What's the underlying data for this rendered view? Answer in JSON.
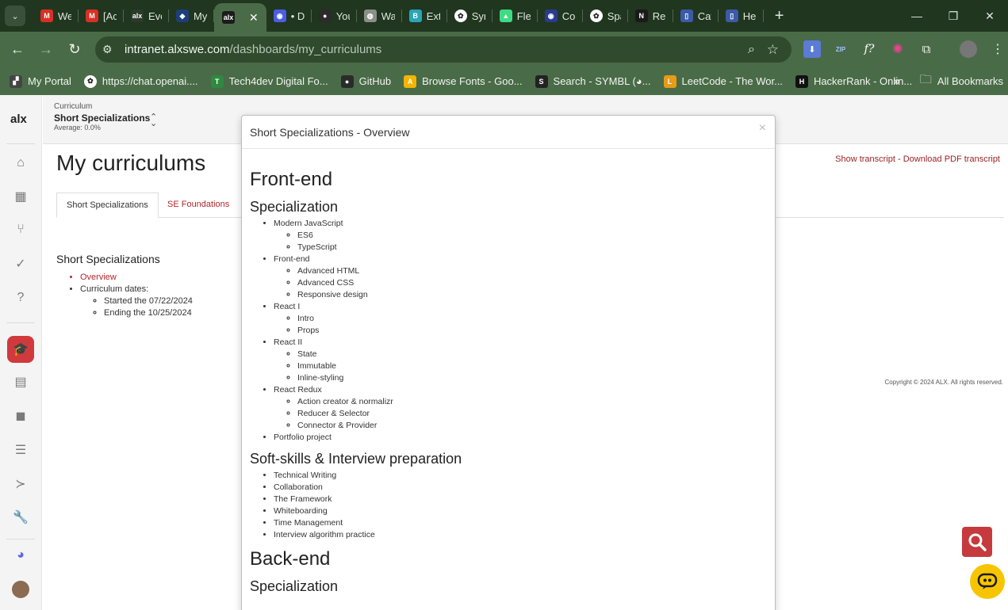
{
  "browser": {
    "tabs": [
      {
        "icon": "gmail-icon",
        "label": "We",
        "color": "#d93025",
        "glyph": "M"
      },
      {
        "icon": "gmail-icon",
        "label": "[Ac",
        "color": "#d93025",
        "glyph": "M"
      },
      {
        "icon": "alx-icon",
        "label": "Eve",
        "color": "#2b3b2a",
        "glyph": "alx"
      },
      {
        "icon": "azure-icon",
        "label": "My",
        "color": "#1c3f7a",
        "glyph": "◆"
      },
      {
        "icon": "alx-icon",
        "label": "",
        "color": "#1b1b1b",
        "glyph": "alx",
        "active": true
      },
      {
        "icon": "chrome-icon",
        "label": "• D",
        "color": "#4b5de4",
        "glyph": "◉"
      },
      {
        "icon": "github-icon",
        "label": "You",
        "color": "#2b2b2b",
        "glyph": "●"
      },
      {
        "icon": "globe-icon",
        "label": "Wa",
        "color": "#8a8f8a",
        "glyph": "◍"
      },
      {
        "icon": "bootstrap-icon",
        "label": "Ext",
        "color": "#2ba5b5",
        "glyph": "B"
      },
      {
        "icon": "openai-icon",
        "label": "Syr",
        "color": "#ffffff",
        "glyph": "✿"
      },
      {
        "icon": "android-icon",
        "label": "Fle",
        "color": "#3ddc84",
        "glyph": "▲"
      },
      {
        "icon": "cursor-icon",
        "label": "Co",
        "color": "#2a3b8f",
        "glyph": "◉"
      },
      {
        "icon": "openai-icon",
        "label": "Spa",
        "color": "#ffffff",
        "glyph": "✿"
      },
      {
        "icon": "nextjs-icon",
        "label": "Re",
        "color": "#1a1a1a",
        "glyph": "N"
      },
      {
        "icon": "doc-icon",
        "label": "Cat",
        "color": "#3b5ba8",
        "glyph": "▯"
      },
      {
        "icon": "doc-icon",
        "label": "He",
        "color": "#3b5ba8",
        "glyph": "▯"
      }
    ],
    "active_close": "✕",
    "new_tab": "+",
    "url_host": "intranet.alxswe.com",
    "url_path": "/dashboards/my_curriculums",
    "bookmarks": [
      {
        "icon": "portal-icon",
        "label": "My Portal",
        "color": "#444",
        "glyph": "▞"
      },
      {
        "icon": "openai-icon",
        "label": "https://chat.openai....",
        "color": "#ffffff",
        "glyph": "✿"
      },
      {
        "icon": "tech4dev-icon",
        "label": "Tech4dev Digital Fo...",
        "color": "#2d8a3e",
        "glyph": "T"
      },
      {
        "icon": "github-icon",
        "label": "GitHub",
        "color": "#2b2b2b",
        "glyph": "●"
      },
      {
        "icon": "fonts-icon",
        "label": "Browse Fonts - Goo...",
        "color": "#f4b400",
        "glyph": "A"
      },
      {
        "icon": "symbl-icon",
        "label": "Search - SYMBL (◕...",
        "color": "#222",
        "glyph": "S"
      },
      {
        "icon": "leetcode-icon",
        "label": "LeetCode - The Wor...",
        "color": "#e79b16",
        "glyph": "L"
      },
      {
        "icon": "hackerrank-icon",
        "label": "HackerRank - Onlin...",
        "color": "#111",
        "glyph": "H"
      }
    ],
    "more_bookmarks": "»",
    "all_bookmarks": "All Bookmarks"
  },
  "app": {
    "logo": "alx",
    "curriculum_label": "Curriculum",
    "curriculum_name": "Short Specializations",
    "curriculum_average": "Average: 0.0%",
    "page_title": "My curriculums",
    "show_transcript": "Show transcript",
    "separator": " - ",
    "download_transcript": "Download PDF transcript",
    "tabs": [
      "Short Specializations",
      "SE Foundations"
    ],
    "section_title": "Short Specializations",
    "overview_link": "Overview",
    "dates_label": "Curriculum dates:",
    "started": "Started the 07/22/2024",
    "ending": "Ending the 10/25/2024",
    "copyright": "Copyright © 2024 ALX. All rights reserved."
  },
  "modal": {
    "title": "Short Specializations - Overview",
    "close": "×",
    "frontend_heading": "Front-end",
    "specialization_heading": "Specialization",
    "specialization_items": [
      {
        "label": "Modern JavaScript",
        "children": [
          "ES6",
          "TypeScript"
        ]
      },
      {
        "label": "Front-end",
        "children": [
          "Advanced HTML",
          "Advanced CSS",
          "Responsive design"
        ]
      },
      {
        "label": "React I",
        "children": [
          "Intro",
          "Props"
        ]
      },
      {
        "label": "React II",
        "children": [
          "State",
          "Immutable",
          "Inline-styling"
        ]
      },
      {
        "label": "React Redux",
        "children": [
          "Action creator & normalizr",
          "Reducer & Selector",
          "Connector & Provider"
        ]
      },
      {
        "label": "Portfolio project",
        "children": []
      }
    ],
    "softskills_heading": "Soft-skills & Interview preparation",
    "softskills_items": [
      "Technical Writing",
      "Collaboration",
      "The Framework",
      "Whiteboarding",
      "Time Management",
      "Interview algorithm practice"
    ],
    "backend_heading": "Back-end",
    "backend_specialization_heading": "Specialization"
  },
  "colors": {
    "accent": "#d03a3d",
    "link": "#b3262a",
    "chrome_dark": "#20361f",
    "chrome": "#4a6b47",
    "chat_button": "#f7c500"
  }
}
